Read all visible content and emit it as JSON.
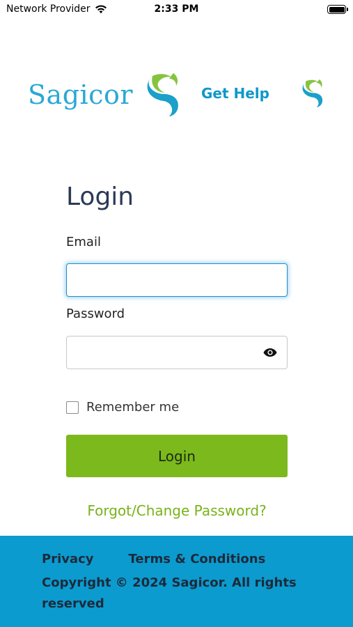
{
  "status_bar": {
    "carrier": "Network Provider",
    "time": "2:33 PM",
    "wifi_icon": "wifi-icon",
    "battery_icon": "battery-icon"
  },
  "header": {
    "logo_text": "Sagicor",
    "help_label": "Get Help"
  },
  "login_form": {
    "title": "Login",
    "email_label": "Email",
    "email_value": "",
    "password_label": "Password",
    "password_value": "",
    "reveal_icon": "eye-icon",
    "remember_label": "Remember me",
    "remember_checked": false,
    "submit_label": "Login",
    "forgot_label": "Forgot/Change Password?"
  },
  "footer": {
    "privacy_label": "Privacy",
    "terms_label": "Terms & Conditions",
    "copyright": "Copyright © 2024 Sagicor. All rights reserved"
  },
  "colors": {
    "brand_blue": "#2aa8d6",
    "brand_green": "#7bb91c",
    "footer_blue": "#0b9bcf",
    "title_navy": "#2b3a55"
  }
}
